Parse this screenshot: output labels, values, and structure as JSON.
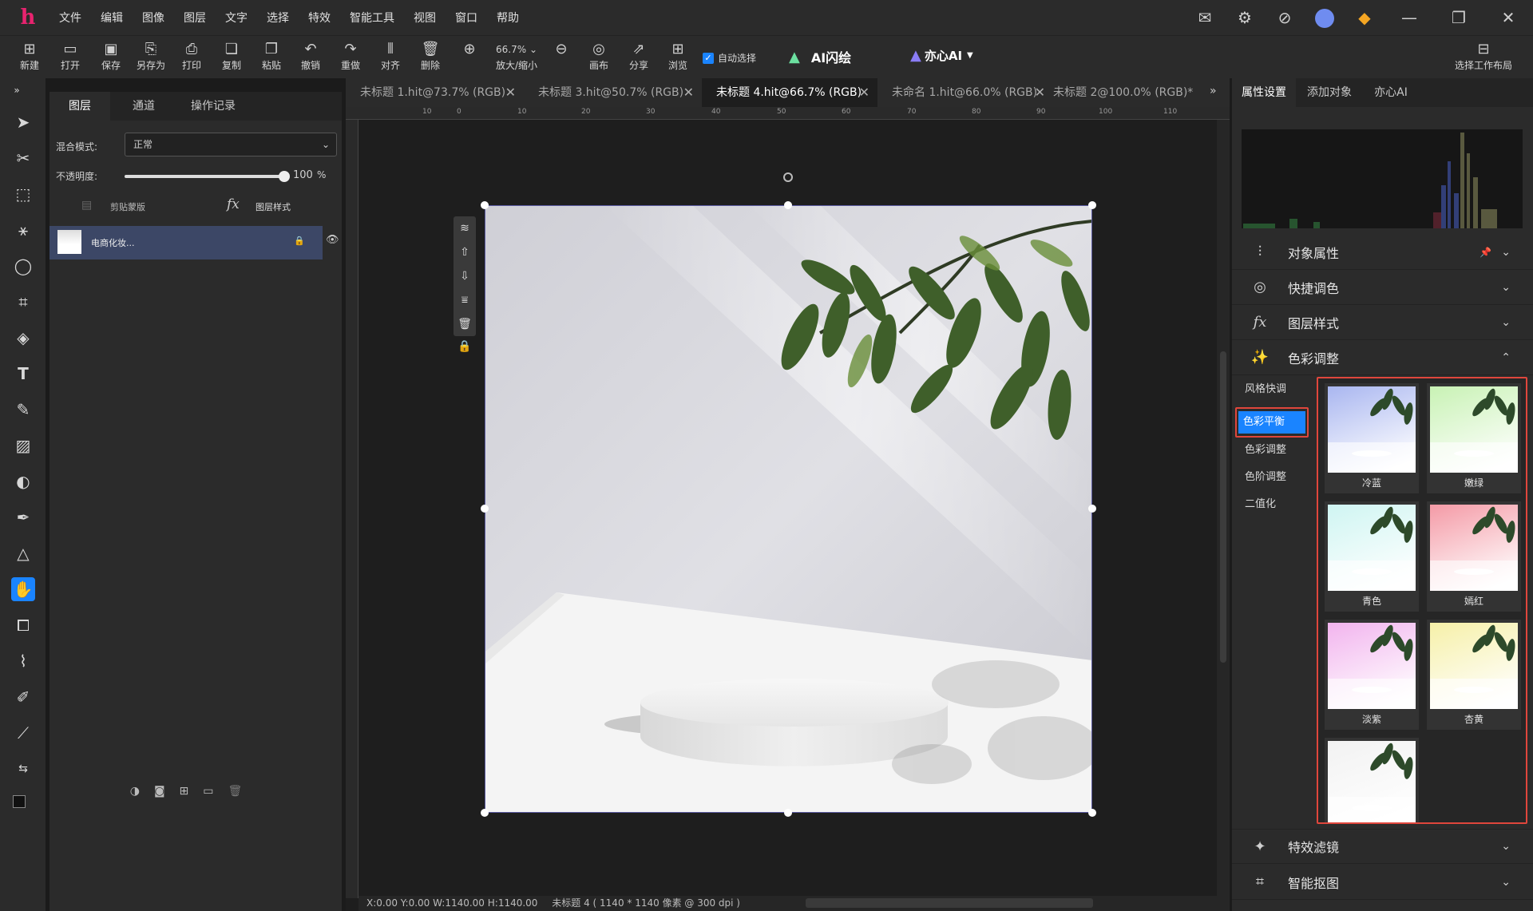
{
  "app": {
    "logo": "h"
  },
  "menu": [
    "文件",
    "编辑",
    "图像",
    "图层",
    "文字",
    "选择",
    "特效",
    "智能工具",
    "视图",
    "窗口",
    "帮助"
  ],
  "window_icons": [
    "mail-icon",
    "settings-icon",
    "compass-icon",
    "avatar",
    "gem-icon",
    "minimize-icon",
    "restore-icon",
    "close-icon"
  ],
  "toolbar": {
    "new": "新建",
    "open": "打开",
    "save": "保存",
    "save_as": "另存为",
    "print": "打印",
    "copy": "复制",
    "paste": "粘贴",
    "undo": "撤销",
    "redo": "重做",
    "align": "对齐",
    "delete": "删除",
    "zoom_value": "66.7%",
    "zoom_label": "放大/缩小",
    "canvas": "画布",
    "share": "分享",
    "browse": "浏览",
    "auto_select": "自动选择",
    "ai_flash": "AI闪绘",
    "yixin_ai": "亦心AI",
    "workspace": "选择工作布局"
  },
  "layers_panel": {
    "tabs": [
      "图层",
      "通道",
      "操作记录"
    ],
    "blend_label": "混合模式:",
    "blend_value": "正常",
    "opacity_label": "不透明度:",
    "opacity_value": "100",
    "opacity_unit": "%",
    "opacity_fraction": 1.0,
    "clip_label": "剪贴蒙版",
    "style_label": "图层样式",
    "fx": "fx",
    "layer_name": "电商化妆..."
  },
  "doc_tabs": [
    {
      "label": "未标题 1.hit@73.7% (RGB)",
      "active": false
    },
    {
      "label": "未标题 3.hit@50.7% (RGB)",
      "active": false
    },
    {
      "label": "未标题 4.hit@66.7% (RGB)",
      "active": true
    },
    {
      "label": "未命名 1.hit@66.0% (RGB)",
      "active": false
    },
    {
      "label": "未标题 2@100.0% (RGB)*",
      "active": false
    }
  ],
  "ruler_labels": [
    "10",
    "0",
    "10",
    "20",
    "30",
    "40",
    "50",
    "60",
    "70",
    "80",
    "90",
    "100",
    "110"
  ],
  "status_bar": {
    "coords": "X:0.00 Y:0.00 W:1140.00 H:1140.00",
    "doc": "未标题 4 ( 1140 * 1140 像素 @ 300 dpi )"
  },
  "right_panel": {
    "tabs": [
      "属性设置",
      "添加对象",
      "亦心AI"
    ],
    "sections": {
      "object_props": "对象属性",
      "quick_color": "快捷调色",
      "layer_style": "图层样式",
      "color_adjust": "色彩调整",
      "effects": "特效滤镜",
      "smart_matting": "智能抠图"
    },
    "categories": [
      "风格快调",
      "色彩平衡",
      "色彩调整",
      "色阶调整",
      "二值化"
    ],
    "selected_category": "色彩平衡",
    "presets": [
      {
        "name": "冷蓝",
        "color": "#a9b6f0"
      },
      {
        "name": "嫩绿",
        "color": "#c8f2b4"
      },
      {
        "name": "青色",
        "color": "#cff5f2"
      },
      {
        "name": "嫣红",
        "color": "#f49aa6"
      },
      {
        "name": "淡紫",
        "color": "#f2b4ee"
      },
      {
        "name": "杏黄",
        "color": "#f6f0a8"
      },
      {
        "name": "",
        "color": "#f2f2f2"
      }
    ]
  },
  "colors": {
    "accent": "#1a84ff",
    "highlight_border": "#e0463c",
    "panel": "#2b2b2b",
    "canvas_bg": "#1e1e1e"
  }
}
